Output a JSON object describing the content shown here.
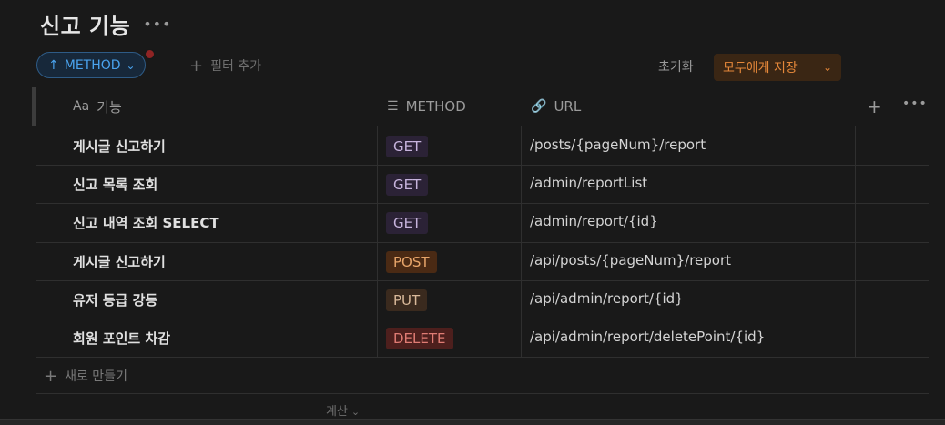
{
  "page": {
    "title": "신고 기능",
    "more_icon": "more-horizontal-icon"
  },
  "toolbar": {
    "sort_arrow": "↑",
    "sort_label": "METHOD",
    "sort_chevron": "⌄",
    "add_filter_plus": "+",
    "add_filter_label": "필터 추가",
    "reset_label": "초기화",
    "save_label": "모두에게 저장",
    "save_chevron": "⌄",
    "colors": {
      "accent_blue": "#4aa3ee",
      "save_orange": "#e6883a"
    }
  },
  "table": {
    "columns": [
      {
        "icon": "Aa",
        "label": "기능"
      },
      {
        "icon": "☰",
        "label": "METHOD"
      },
      {
        "icon": "🔗",
        "label": "URL"
      }
    ],
    "add_column": "+",
    "more": "•••",
    "rows": [
      {
        "name": "게시글 신고하기",
        "method": "GET",
        "url": "/posts/{pageNum}/report"
      },
      {
        "name": "신고 목록 조회",
        "method": "GET",
        "url": "/admin/reportList"
      },
      {
        "name": "신고 내역 조회 SELECT",
        "method": "GET",
        "url": "/admin/report/{id}"
      },
      {
        "name": "게시글 신고하기",
        "method": "POST",
        "url": "/api/posts/{pageNum}/report"
      },
      {
        "name": "유저 등급 강등",
        "method": "PUT",
        "url": "/api/admin/report/{id}"
      },
      {
        "name": "회원 포인트 차감",
        "method": "DELETE",
        "url": "/api/admin/report/deletePoint/{id}"
      }
    ],
    "new_row_plus": "+",
    "new_row_label": "새로 만들기",
    "calc_label": "계산",
    "calc_chevron": "⌄"
  }
}
